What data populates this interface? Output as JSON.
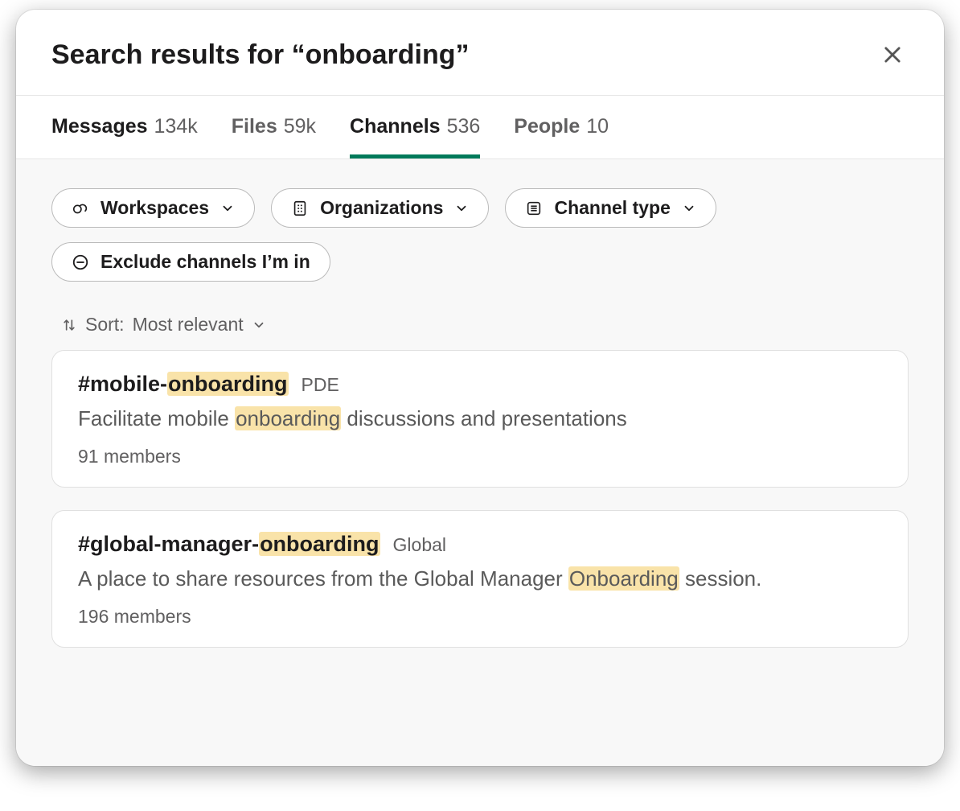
{
  "header": {
    "title_prefix": "Search results for ",
    "query_quoted": "“onboarding”"
  },
  "tabs": [
    {
      "label": "Messages",
      "count": "134k",
      "active": false,
      "dark": true
    },
    {
      "label": "Files",
      "count": "59k",
      "active": false,
      "dark": false
    },
    {
      "label": "Channels",
      "count": "536",
      "active": true,
      "dark": true
    },
    {
      "label": "People",
      "count": "10",
      "active": false,
      "dark": false
    }
  ],
  "filters": {
    "workspaces": "Workspaces",
    "organizations": "Organizations",
    "channel_type": "Channel type",
    "exclude": "Exclude channels I’m in"
  },
  "sort": {
    "label_prefix": "Sort: ",
    "value": "Most relevant"
  },
  "results": [
    {
      "hash": "#",
      "name_pre": "mobile-",
      "name_hl": "onboarding",
      "name_post": "",
      "tag": "PDE",
      "desc_pre": "Facilitate mobile ",
      "desc_hl": "onboarding",
      "desc_post": " discussions and presentations",
      "members": "91 members"
    },
    {
      "hash": "#",
      "name_pre": "global-manager-",
      "name_hl": "onboarding",
      "name_post": "",
      "tag": "Global",
      "desc_pre": "A place to share resources from the Global Manager ",
      "desc_hl": "Onboarding",
      "desc_post": " session.",
      "members": "196 members"
    }
  ]
}
